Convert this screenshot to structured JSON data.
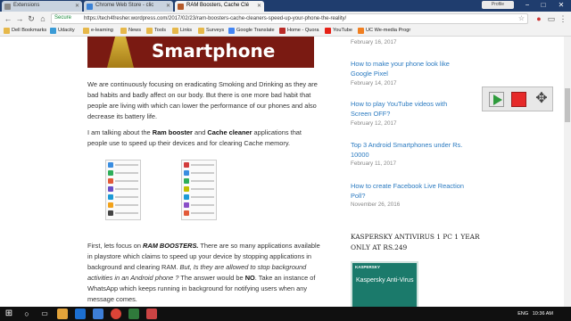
{
  "tabs": [
    {
      "label": "Extensions",
      "active": false,
      "icon": "puzzle-icon",
      "color": "#8a8a8a"
    },
    {
      "label": "Chrome Web Store - clic",
      "active": false,
      "icon": "webstore-icon",
      "color": "#3b82d6"
    },
    {
      "label": "RAM Boosters, Cache Clé",
      "active": true,
      "icon": "site-favicon",
      "color": "#b55a2a"
    }
  ],
  "window": {
    "profile": "Profile",
    "minimize": "−",
    "maximize": "□",
    "close": "✕"
  },
  "address_bar": {
    "secure_label": "Secure",
    "url": "https://tech4fresher.wordpress.com/2017/02/23/ram-boosters-cache-cleaners-speed-up-your-phone-the-reality/",
    "back": "←",
    "forward": "→",
    "reload": "↻",
    "home": "⌂",
    "star": "☆"
  },
  "bookmarks": [
    {
      "label": "Dell Bookmarks",
      "color": "#e6b84a"
    },
    {
      "label": "Udacity",
      "color": "#3a9bd6"
    },
    {
      "label": "e-learning",
      "color": "#e6b84a"
    },
    {
      "label": "News",
      "color": "#e6b84a"
    },
    {
      "label": "Tools",
      "color": "#e6b84a"
    },
    {
      "label": "Links",
      "color": "#e6b84a"
    },
    {
      "label": "Surveys",
      "color": "#e6b84a"
    },
    {
      "label": "Google Translate",
      "color": "#4285f4"
    },
    {
      "label": "Home - Quora",
      "color": "#b92b27"
    },
    {
      "label": "YouTube",
      "color": "#e62117"
    },
    {
      "label": "UC We-media Progr",
      "color": "#f07f21"
    }
  ],
  "article": {
    "banner_text": "Smartphone",
    "para1": "We are continuously focusing on eradicating Smoking and Drinking as they are bad habits and badly affect on our body. But there is one more bad habit that people are living with which can lower the performance of our phones and also decrease its battery life.",
    "para2_pre": "I am talking about the ",
    "para2_b1": "Ram booster",
    "para2_mid": " and ",
    "para2_b2": "Cache cleaner",
    "para2_post": " applications that people use to speed up their devices and for clearing Cache memory.",
    "para3_pre": "First, lets focus on ",
    "para3_b": "RAM BOOSTERS.",
    "para3_post": " There are so many applications available in playstore which claims to speed up your device by stopping applications in background and clearing RAM. ",
    "para3_italic": "But, Is they are allowed to stop background activities in an Android phone ?",
    "para3_tail": " The answer would be ",
    "para3_no": "NO",
    "para3_end": ". Take an instance of WhatsApp which keeps running in background for notifying users when any message comes."
  },
  "sidebar": {
    "top_date": "February 16, 2017",
    "posts": [
      {
        "title": "How to make your phone look like Google Pixel",
        "date": "February 14, 2017"
      },
      {
        "title": "How to play YouTube videos with Screen OFF?",
        "date": "February 12, 2017"
      },
      {
        "title": "Top 3 Android Smartphones under Rs. 10000",
        "date": "February 11, 2017"
      },
      {
        "title": "How to create Facebook Live Reaction Poll?",
        "date": "November 26, 2016"
      }
    ],
    "ad_title": "KASPERSKY ANTIVIRUS 1 PC 1 YEAR ONLY AT RS.249",
    "ad_brand": "KASPERSKY",
    "ad_product": "Kaspersky Anti-Virus"
  },
  "recorder": {
    "play": "play-icon",
    "stop": "stop-icon",
    "move": "✥"
  },
  "taskbar": {
    "time": "10:36 AM",
    "lang": "ENG"
  }
}
